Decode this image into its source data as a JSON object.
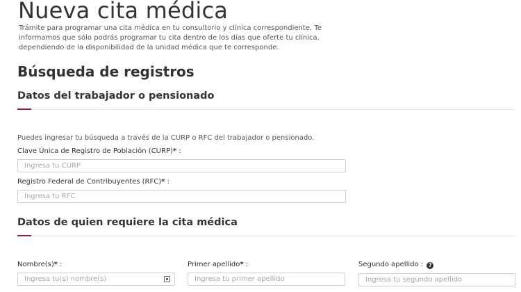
{
  "page": {
    "title": "Nueva cita médica",
    "intro": "Trámite para programar una cita médica en tu consultorio y clínica correspondiente. Te informamos que sólo podrás programar tu cita dentro de los días que oferte tu clínica, dependiendo de la disponibilidad de la unidad médica que te corresponde."
  },
  "search": {
    "heading": "Búsqueda de registros"
  },
  "worker_section": {
    "heading": "Datos del trabajador o pensionado",
    "hint": "Puedes ingresar tu búsqueda a través de la CURP o RFC del trabajador o pensionado.",
    "curp": {
      "label": "Clave Única de Registro de Población (CURP)",
      "required_mark": "*",
      "suffix": " :",
      "placeholder": "Ingresa tu CURP",
      "value": ""
    },
    "rfc": {
      "label": "Registro Federal de Contribuyentes (RFC)",
      "required_mark": "*",
      "suffix": " :",
      "placeholder": "Ingresa tu RFC",
      "value": ""
    }
  },
  "patient_section": {
    "heading": "Datos de quien requiere la cita médica",
    "nombre": {
      "label": "Nombre(s)",
      "required_mark": "*",
      "suffix": " :",
      "placeholder": "Ingresa tu(s) nombre(s)",
      "value": ""
    },
    "primer_apellido": {
      "label": "Primer apellido",
      "required_mark": "*",
      "suffix": " :",
      "placeholder": "Ingresa tu primer apellido",
      "value": ""
    },
    "segundo_apellido": {
      "label": "Segundo apellido :",
      "help_glyph": "?",
      "placeholder": "Ingresa tu segundo apellido",
      "value": ""
    }
  },
  "icons": {
    "nombre_field": "contact-card-icon",
    "segundo_help": "question-circle-icon"
  },
  "colors": {
    "accent": "#9d2449",
    "divider": "#e6e6e6",
    "text": "#333333"
  }
}
